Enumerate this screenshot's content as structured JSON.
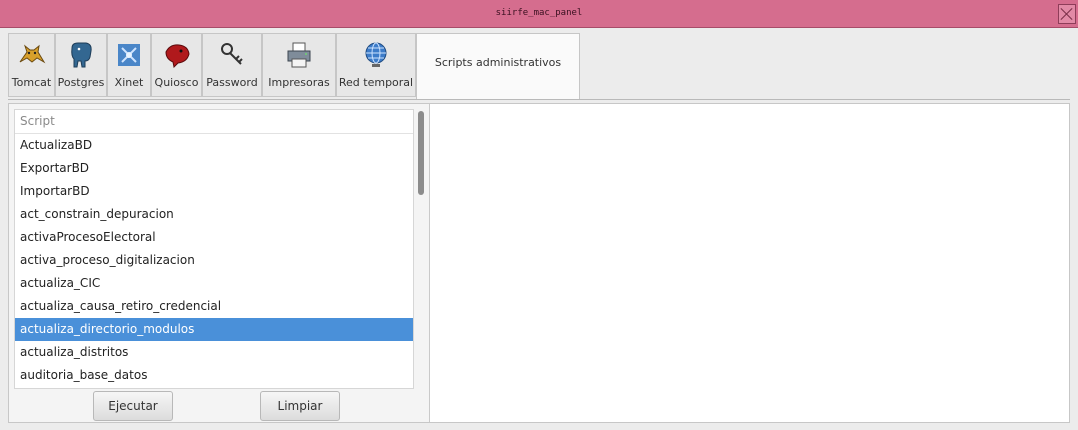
{
  "window": {
    "title": "siirfe_mac_panel"
  },
  "tabs": [
    {
      "label": "Tomcat",
      "icon": "tomcat-icon"
    },
    {
      "label": "Postgres",
      "icon": "postgres-elephant-icon"
    },
    {
      "label": "Xinet",
      "icon": "xinet-icon"
    },
    {
      "label": "Quiosco",
      "icon": "quiosco-icon"
    },
    {
      "label": "Password",
      "icon": "key-icon"
    },
    {
      "label": "Impresoras",
      "icon": "printer-icon"
    },
    {
      "label": "Red temporal",
      "icon": "network-globe-icon"
    },
    {
      "label": "Scripts administrativos",
      "icon": ""
    }
  ],
  "active_tab": "Scripts administrativos",
  "scripts": {
    "column_header": "Script",
    "rows": [
      "ActualizaBD",
      "ExportarBD",
      "ImportarBD",
      "act_constrain_depuracion",
      "activaProcesoElectoral",
      "activa_proceso_digitalizacion",
      "actualiza_CIC",
      "actualiza_causa_retiro_credencial",
      "actualiza_directorio_modulos",
      "actualiza_distritos",
      "auditoria_base_datos"
    ],
    "selected": "actualiza_directorio_modulos"
  },
  "buttons": {
    "run": "Ejecutar",
    "clear": "Limpiar"
  },
  "colors": {
    "titlebar": "#d56d8e",
    "selection": "#4a90d9"
  }
}
